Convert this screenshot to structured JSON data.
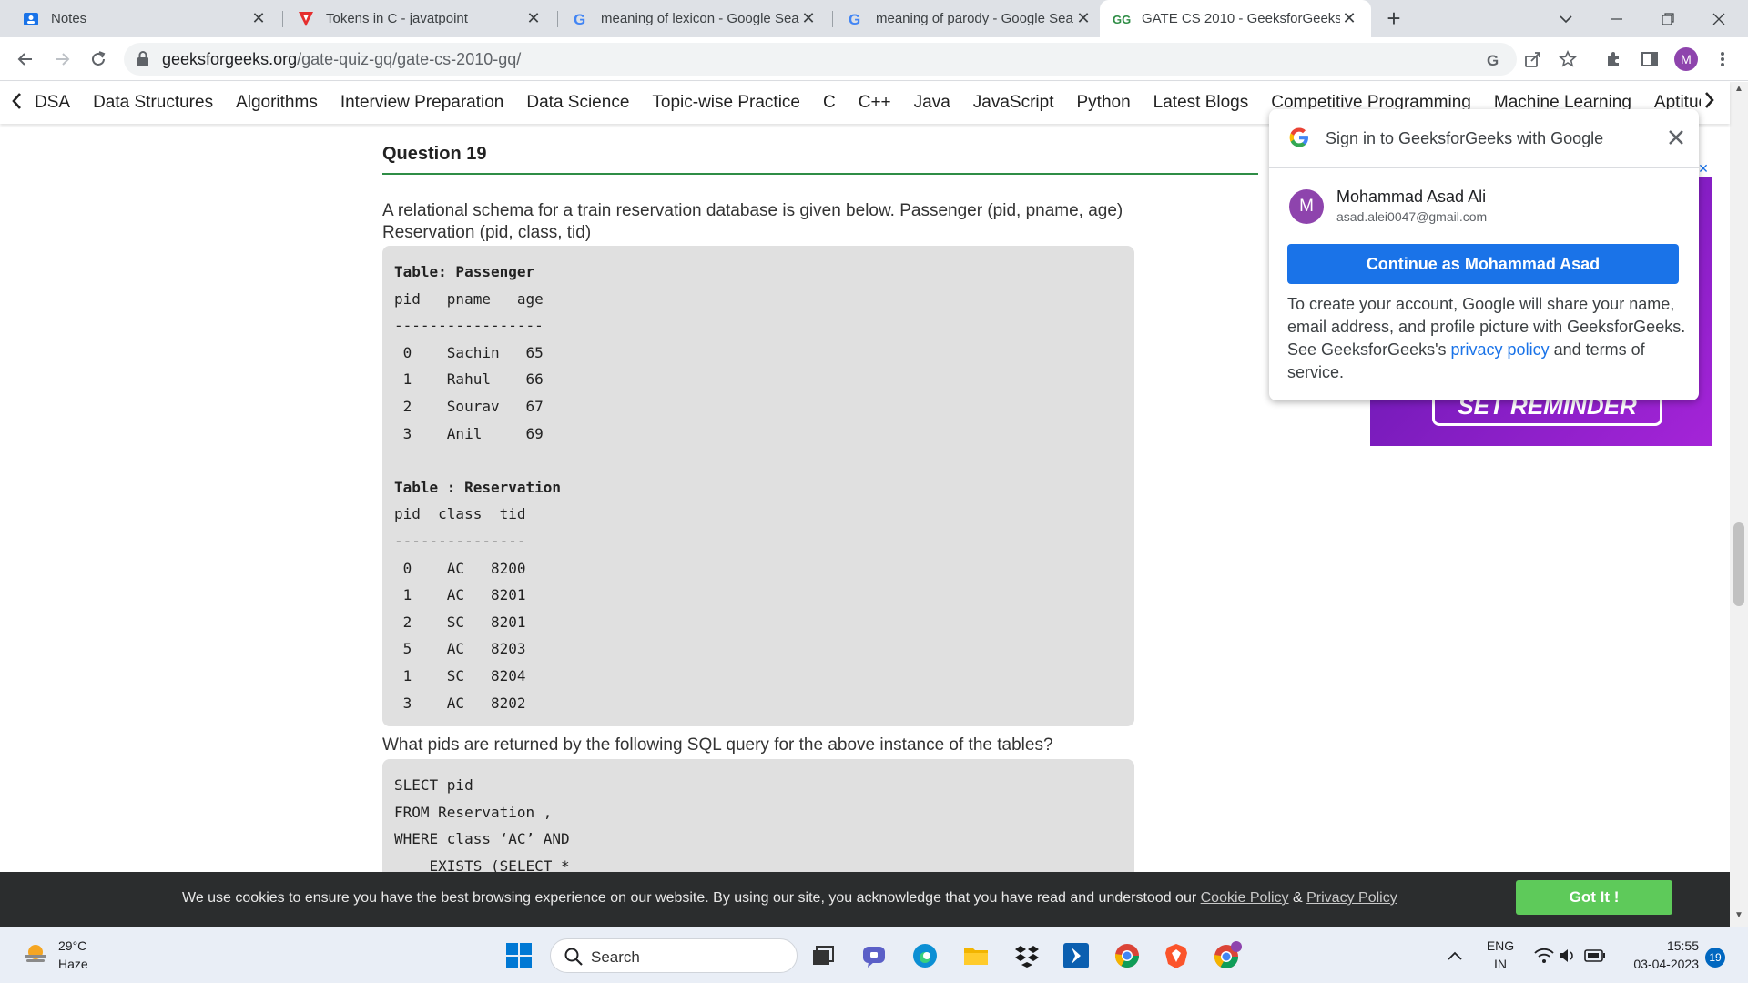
{
  "tabs": [
    {
      "title": "Notes",
      "icon": "notes-icon"
    },
    {
      "title": "Tokens in C - javatpoint",
      "icon": "javatpoint-icon"
    },
    {
      "title": "meaning of lexicon - Google Sea",
      "icon": "google-icon"
    },
    {
      "title": "meaning of parody - Google Sea",
      "icon": "google-icon"
    },
    {
      "title": "GATE CS 2010 - GeeksforGeeks",
      "icon": "gfg-icon"
    }
  ],
  "browser": {
    "url_host": "geeksforgeeks.org",
    "url_path": "/gate-quiz-gq/gate-cs-2010-gq/",
    "profile_initial": "M"
  },
  "sitenav": {
    "items": [
      "DSA",
      "Data Structures",
      "Algorithms",
      "Interview Preparation",
      "Data Science",
      "Topic-wise Practice",
      "C",
      "C++",
      "Java",
      "JavaScript",
      "Python",
      "Latest Blogs",
      "Competitive Programming",
      "Machine Learning",
      "Aptitude"
    ]
  },
  "question": {
    "title": "Question 19",
    "text": "A relational schema for a train reservation database is given below. Passenger (pid, pname, age) Reservation (pid, class, tid)",
    "tables_code": [
      "Table: Passenger",
      "pid   pname   age",
      "-----------------",
      " 0    Sachin   65",
      " 1    Rahul    66",
      " 2    Sourav   67",
      " 3    Anil     69",
      "",
      "Table : Reservation",
      "pid  class  tid",
      "---------------",
      " 0    AC   8200",
      " 1    AC   8201",
      " 2    SC   8201",
      " 5    AC   8203",
      " 1    SC   8204",
      " 3    AC   8202"
    ],
    "prompt": "What pids are returned by the following SQL query for the above instance of the tables?",
    "sql_code": [
      "SLECT pid",
      "FROM Reservation ,",
      "WHERE class ‘AC’ AND",
      "    EXISTS (SELECT *"
    ]
  },
  "ad": {
    "button_label": "SET REMINDER",
    "close_label": "✕"
  },
  "google_popup": {
    "title": "Sign in to GeeksforGeeks with Google",
    "user_initial": "M",
    "user_name": "Mohammad Asad Ali",
    "user_email": "asad.alei0047@gmail.com",
    "continue_label": "Continue as Mohammad Asad",
    "body_before": "To create your account, Google will share your name, email address, and profile picture with GeeksforGeeks. See GeeksforGeeks's ",
    "body_link": "privacy policy",
    "body_after": " and terms of service."
  },
  "cookie": {
    "text": "We use cookies to ensure you have the best browsing experience on our website. By using our site, you acknowledge that you have read and understood our ",
    "cookie_policy": "Cookie Policy",
    "amp": " & ",
    "privacy_policy": "Privacy Policy",
    "button": "Got It !"
  },
  "taskbar": {
    "temperature": "29°C",
    "condition": "Haze",
    "search_label": "Search",
    "lang_top": "ENG",
    "lang_bottom": "IN",
    "time": "15:55",
    "date": "03-04-2023",
    "notification_count": "19"
  },
  "colors": {
    "gfg_green": "#2f8d46",
    "google_blue": "#1a73e8",
    "cookie_button": "#5eca5a"
  }
}
